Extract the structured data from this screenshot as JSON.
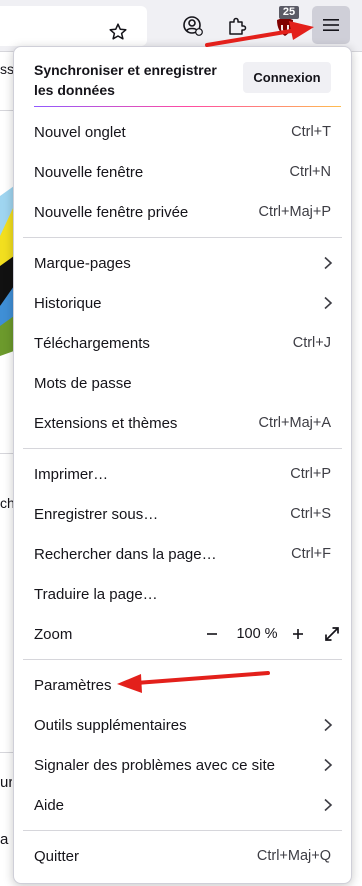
{
  "page_fragments": {
    "top": "ss",
    "middle": "cha",
    "lower1": "ur",
    "lower2": "a r"
  },
  "toolbar": {
    "ublock_badge": "25"
  },
  "sync": {
    "title": "Synchroniser et enregistrer les données",
    "button": "Connexion"
  },
  "menu": {
    "new_tab": {
      "label": "Nouvel onglet",
      "shortcut": "Ctrl+T"
    },
    "new_window": {
      "label": "Nouvelle fenêtre",
      "shortcut": "Ctrl+N"
    },
    "private_window": {
      "label": "Nouvelle fenêtre privée",
      "shortcut": "Ctrl+Maj+P"
    },
    "bookmarks": {
      "label": "Marque-pages"
    },
    "history": {
      "label": "Historique"
    },
    "downloads": {
      "label": "Téléchargements",
      "shortcut": "Ctrl+J"
    },
    "passwords": {
      "label": "Mots de passe"
    },
    "addons": {
      "label": "Extensions et thèmes",
      "shortcut": "Ctrl+Maj+A"
    },
    "print": {
      "label": "Imprimer…",
      "shortcut": "Ctrl+P"
    },
    "save_as": {
      "label": "Enregistrer sous…",
      "shortcut": "Ctrl+S"
    },
    "find": {
      "label": "Rechercher dans la page…",
      "shortcut": "Ctrl+F"
    },
    "translate": {
      "label": "Traduire la page…"
    },
    "zoom": {
      "label": "Zoom",
      "value": "100 %"
    },
    "settings": {
      "label": "Paramètres"
    },
    "more_tools": {
      "label": "Outils supplémentaires"
    },
    "report": {
      "label": "Signaler des problèmes avec ce site"
    },
    "help": {
      "label": "Aide"
    },
    "quit": {
      "label": "Quitter",
      "shortcut": "Ctrl+Maj+Q"
    }
  },
  "colors": {
    "annotation_arrow": "#e3201b",
    "ublock_red": "#800000",
    "menu_button_active": "#cfcfd8"
  }
}
